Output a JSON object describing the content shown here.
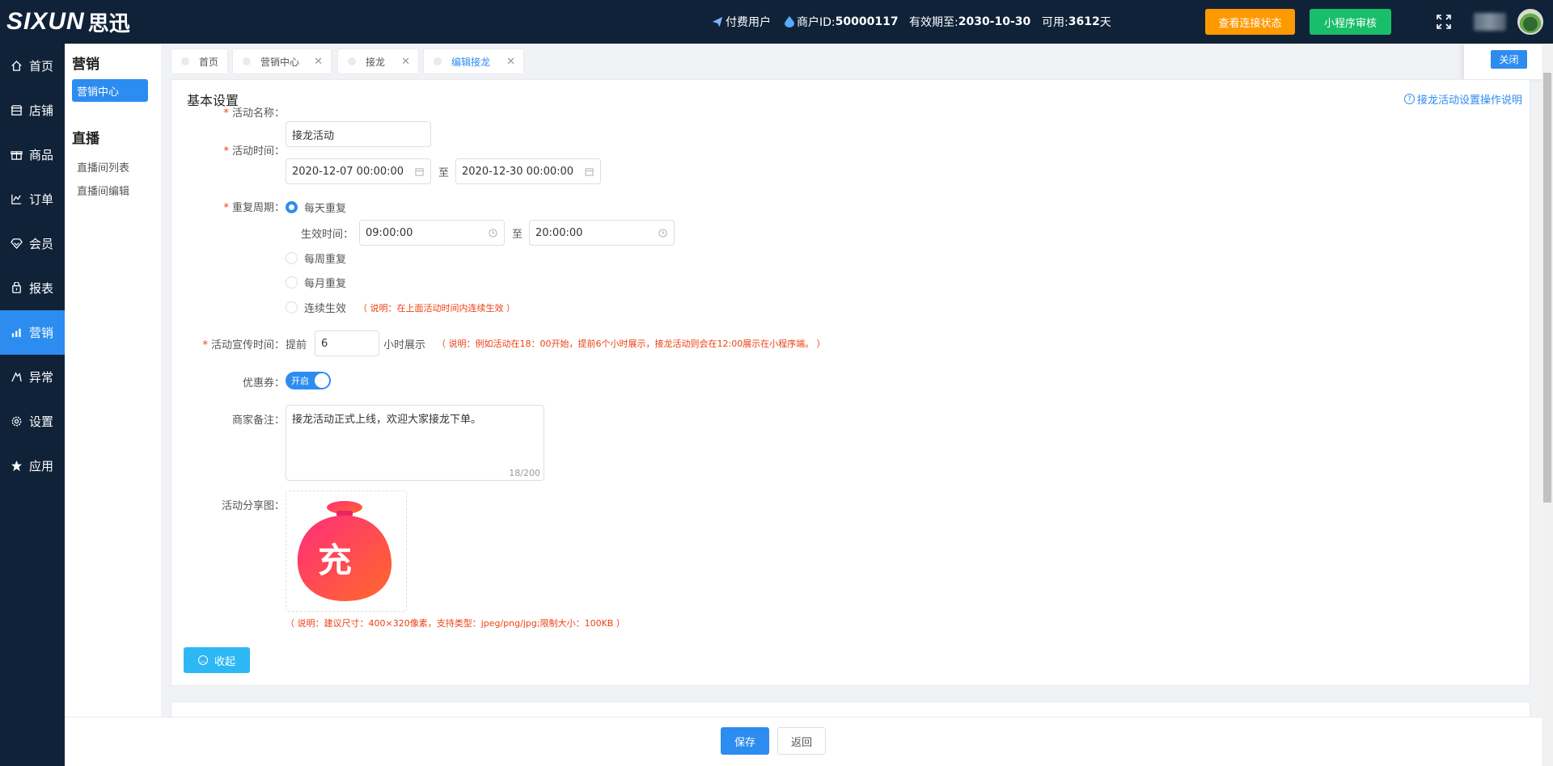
{
  "header": {
    "logo": "SIXUN",
    "logo_cn": "思迅",
    "paid_user": "付费用户",
    "merchant_label": "商户ID:",
    "merchant_id": "50000117",
    "valid_label": "有效期至:",
    "valid_until": "2030-10-30",
    "available_label": "可用: ",
    "available_days": "3612",
    "days_unit": " 天",
    "connect_status_button": "查看连接状态",
    "mini_program_button": "小程序审核"
  },
  "rail": {
    "items": [
      {
        "label": "首页",
        "icon": "home-icon"
      },
      {
        "label": "店铺",
        "icon": "store-icon"
      },
      {
        "label": "商品",
        "icon": "gift-icon"
      },
      {
        "label": "订单",
        "icon": "order-icon"
      },
      {
        "label": "会员",
        "icon": "member-icon"
      },
      {
        "label": "报表",
        "icon": "report-icon"
      },
      {
        "label": "营销",
        "icon": "bar-chart-icon"
      },
      {
        "label": "异常",
        "icon": "exception-icon"
      },
      {
        "label": "设置",
        "icon": "gear-icon"
      },
      {
        "label": "应用",
        "icon": "star-icon"
      }
    ],
    "active_index": 6
  },
  "subnav": {
    "group1_title": "营销",
    "group1_active": "营销中心",
    "group2_title": "直播",
    "group2_items": [
      "直播间列表",
      "直播间编辑"
    ]
  },
  "tabs": [
    {
      "label": "首页",
      "closable": false
    },
    {
      "label": "营销中心",
      "closable": true
    },
    {
      "label": "接龙",
      "closable": true
    },
    {
      "label": "编辑接龙",
      "closable": true,
      "active": true
    }
  ],
  "close_button": "关闭",
  "form": {
    "section_title": "基本设置",
    "help_link": "接龙活动设置操作说明",
    "name_label": "活动名称：",
    "name_value": "接龙活动",
    "time_label": "活动时间：",
    "start_time": "2020-12-07 00:00:00",
    "to": "至",
    "end_time": "2020-12-30 00:00:00",
    "repeat_label": "重复周期：",
    "repeat_daily": "每天重复",
    "effective_time_label": "生效时间：",
    "effective_start": "09:00:00",
    "effective_end": "20:00:00",
    "repeat_weekly": "每周重复",
    "repeat_monthly": "每月重复",
    "repeat_continuous": "连续生效",
    "continuous_note": "（ 说明：在上面活动时间内连续生效 ）",
    "promo_label": "活动宣传时间：",
    "promo_prefix": "提前",
    "promo_hours": "6",
    "promo_suffix": "小时展示",
    "promo_note": "（ 说明：例如活动在18：00开始，提前6个小时展示，接龙活动则会在12:00展示在小程序端。 ）",
    "coupon_label": "优惠券：",
    "coupon_toggle": "开启",
    "remark_label": "商家备注：",
    "remark_value": "接龙活动正式上线，欢迎大家接龙下单。",
    "remark_count": "18/200",
    "share_image_label": "活动分享图：",
    "share_image_char": "充",
    "share_image_note": "（ 说明：建议尺寸：400×320像素，支持类型：jpeg/png/jpg;限制大小：100KB ）",
    "collapse_button": "收起"
  },
  "footer": {
    "save_button": "保存",
    "back_button": "返回"
  },
  "colors": {
    "topbar": "#0f2238",
    "primary": "#2d8cf0",
    "orange": "#ff9900",
    "green": "#19be6b",
    "danger": "#ed4014",
    "info": "#2db7f5"
  }
}
